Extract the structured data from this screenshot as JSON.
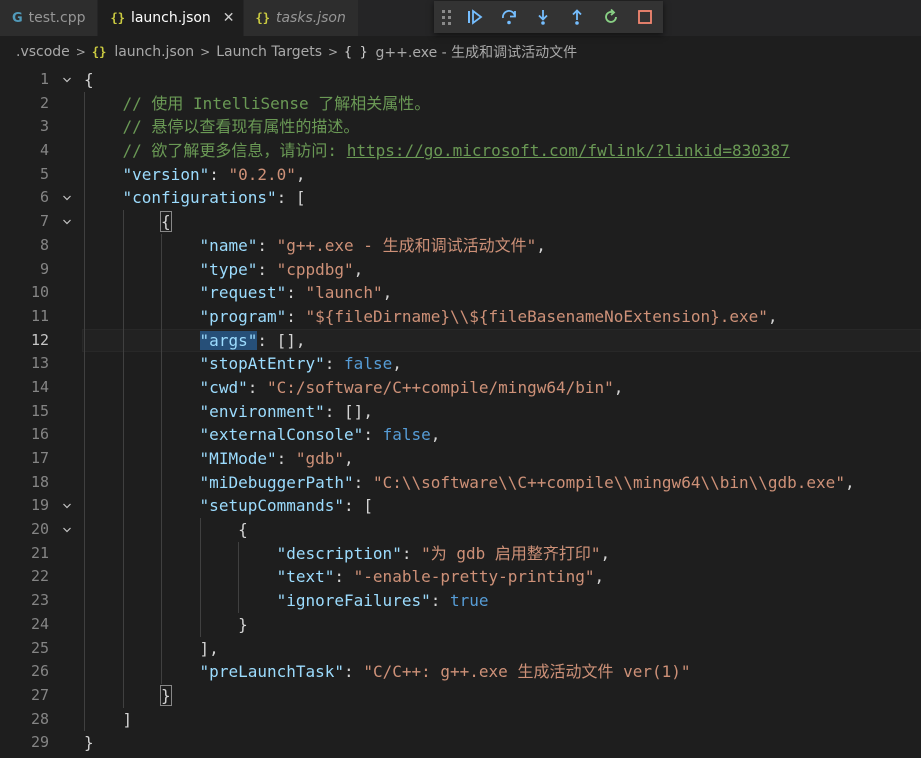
{
  "tabs": [
    {
      "label": "test.cpp",
      "icon": "cpp-file-icon",
      "active": false
    },
    {
      "label": "launch.json",
      "icon": "json-file-icon",
      "active": true,
      "close": "✕"
    },
    {
      "label": "tasks.json",
      "icon": "json-file-icon",
      "active": false
    }
  ],
  "icons": {
    "json": "{}",
    "object": "{ }"
  },
  "debug_toolbar": [
    "continue-icon",
    "step-over-icon",
    "step-into-icon",
    "step-out-icon",
    "restart-icon",
    "stop-icon"
  ],
  "breadcrumb": [
    ".vscode",
    "launch.json",
    "Launch Targets",
    "g++.exe - 生成和调试活动文件"
  ],
  "editor": {
    "current_line": 12,
    "lines": [
      {
        "n": "1",
        "fold": "v",
        "indent": 0,
        "tokens": [
          [
            "punc",
            "{"
          ]
        ]
      },
      {
        "n": "2",
        "indent": 1,
        "tokens": [
          [
            "cmt",
            "// 使用 IntelliSense 了解相关属性。"
          ]
        ]
      },
      {
        "n": "3",
        "indent": 1,
        "tokens": [
          [
            "cmt",
            "// 悬停以查看现有属性的描述。"
          ]
        ]
      },
      {
        "n": "4",
        "indent": 1,
        "tokens": [
          [
            "cmt",
            "// 欲了解更多信息，请访问: "
          ],
          [
            "link",
            "https://go.microsoft.com/fwlink/?linkid=830387"
          ]
        ]
      },
      {
        "n": "5",
        "indent": 1,
        "tokens": [
          [
            "key",
            "\"version\""
          ],
          [
            "punc",
            ": "
          ],
          [
            "str",
            "\"0.2.0\""
          ],
          [
            "punc",
            ","
          ]
        ]
      },
      {
        "n": "6",
        "fold": "v",
        "indent": 1,
        "tokens": [
          [
            "key",
            "\"configurations\""
          ],
          [
            "punc",
            ": ["
          ]
        ]
      },
      {
        "n": "7",
        "fold": "v",
        "indent": 2,
        "tokens": [
          [
            "punc-box",
            "{"
          ]
        ]
      },
      {
        "n": "8",
        "indent": 3,
        "tokens": [
          [
            "key",
            "\"name\""
          ],
          [
            "punc",
            ": "
          ],
          [
            "str",
            "\"g++.exe - 生成和调试活动文件\""
          ],
          [
            "punc",
            ","
          ]
        ]
      },
      {
        "n": "9",
        "indent": 3,
        "tokens": [
          [
            "key",
            "\"type\""
          ],
          [
            "punc",
            ": "
          ],
          [
            "str",
            "\"cppdbg\""
          ],
          [
            "punc",
            ","
          ]
        ]
      },
      {
        "n": "10",
        "indent": 3,
        "tokens": [
          [
            "key",
            "\"request\""
          ],
          [
            "punc",
            ": "
          ],
          [
            "str",
            "\"launch\""
          ],
          [
            "punc",
            ","
          ]
        ]
      },
      {
        "n": "11",
        "indent": 3,
        "tokens": [
          [
            "key",
            "\"program\""
          ],
          [
            "punc",
            ": "
          ],
          [
            "str",
            "\"${fileDirname}\\\\${fileBasenameNoExtension}.exe\""
          ],
          [
            "punc",
            ","
          ]
        ]
      },
      {
        "n": "12",
        "indent": 3,
        "tokens": [
          [
            "key-sel",
            "\"args\""
          ],
          [
            "punc",
            ": [],"
          ]
        ]
      },
      {
        "n": "13",
        "indent": 3,
        "tokens": [
          [
            "key",
            "\"stopAtEntry\""
          ],
          [
            "punc",
            ": "
          ],
          [
            "bool",
            "false"
          ],
          [
            "punc",
            ","
          ]
        ]
      },
      {
        "n": "14",
        "indent": 3,
        "tokens": [
          [
            "key",
            "\"cwd\""
          ],
          [
            "punc",
            ": "
          ],
          [
            "str",
            "\"C:/software/C++compile/mingw64/bin\""
          ],
          [
            "punc",
            ","
          ]
        ]
      },
      {
        "n": "15",
        "indent": 3,
        "tokens": [
          [
            "key",
            "\"environment\""
          ],
          [
            "punc",
            ": [],"
          ]
        ]
      },
      {
        "n": "16",
        "indent": 3,
        "tokens": [
          [
            "key",
            "\"externalConsole\""
          ],
          [
            "punc",
            ": "
          ],
          [
            "bool",
            "false"
          ],
          [
            "punc",
            ","
          ]
        ]
      },
      {
        "n": "17",
        "indent": 3,
        "tokens": [
          [
            "key",
            "\"MIMode\""
          ],
          [
            "punc",
            ": "
          ],
          [
            "str",
            "\"gdb\""
          ],
          [
            "punc",
            ","
          ]
        ]
      },
      {
        "n": "18",
        "indent": 3,
        "tokens": [
          [
            "key",
            "\"miDebuggerPath\""
          ],
          [
            "punc",
            ": "
          ],
          [
            "str",
            "\"C:\\\\software\\\\C++compile\\\\mingw64\\\\bin\\\\gdb.exe\""
          ],
          [
            "punc",
            ","
          ]
        ]
      },
      {
        "n": "19",
        "fold": "v",
        "indent": 3,
        "tokens": [
          [
            "key",
            "\"setupCommands\""
          ],
          [
            "punc",
            ": ["
          ]
        ]
      },
      {
        "n": "20",
        "fold": "v",
        "indent": 4,
        "tokens": [
          [
            "punc",
            "{"
          ]
        ]
      },
      {
        "n": "21",
        "indent": 5,
        "tokens": [
          [
            "key",
            "\"description\""
          ],
          [
            "punc",
            ": "
          ],
          [
            "str",
            "\"为 gdb 启用整齐打印\""
          ],
          [
            "punc",
            ","
          ]
        ]
      },
      {
        "n": "22",
        "indent": 5,
        "tokens": [
          [
            "key",
            "\"text\""
          ],
          [
            "punc",
            ": "
          ],
          [
            "str",
            "\"-enable-pretty-printing\""
          ],
          [
            "punc",
            ","
          ]
        ]
      },
      {
        "n": "23",
        "indent": 5,
        "tokens": [
          [
            "key",
            "\"ignoreFailures\""
          ],
          [
            "punc",
            ": "
          ],
          [
            "bool",
            "true"
          ]
        ]
      },
      {
        "n": "24",
        "indent": 4,
        "tokens": [
          [
            "punc",
            "}"
          ]
        ]
      },
      {
        "n": "25",
        "indent": 3,
        "tokens": [
          [
            "punc",
            "],"
          ]
        ]
      },
      {
        "n": "26",
        "indent": 3,
        "tokens": [
          [
            "key",
            "\"preLaunchTask\""
          ],
          [
            "punc",
            ": "
          ],
          [
            "str",
            "\"C/C++: g++.exe 生成活动文件 ver(1)\""
          ]
        ]
      },
      {
        "n": "27",
        "indent": 2,
        "tokens": [
          [
            "punc-box",
            "}"
          ]
        ]
      },
      {
        "n": "28",
        "indent": 1,
        "tokens": [
          [
            "punc",
            "]"
          ]
        ]
      },
      {
        "n": "29",
        "indent": 0,
        "tokens": [
          [
            "punc",
            "}"
          ]
        ]
      }
    ]
  }
}
